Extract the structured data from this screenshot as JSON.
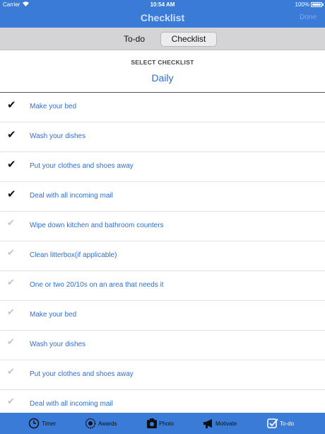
{
  "status_bar": {
    "carrier": "Carrier",
    "time": "10:54 AM",
    "battery": "100%"
  },
  "nav": {
    "title": "Checklist",
    "done_label": "Done"
  },
  "segments": {
    "todo": "To-do",
    "checklist": "Checklist",
    "selected": "Checklist"
  },
  "selector": {
    "label": "SELECT CHECKLIST",
    "value": "Daily"
  },
  "items": [
    {
      "label": "Make your bed",
      "checked": true
    },
    {
      "label": "Wash your dishes",
      "checked": true
    },
    {
      "label": "Put your clothes and shoes away",
      "checked": true
    },
    {
      "label": "Deal with all incoming mail",
      "checked": true
    },
    {
      "label": "Wipe down kitchen and bathroom counters",
      "checked": false
    },
    {
      "label": "Clean litterbox(if applicable)",
      "checked": false
    },
    {
      "label": "One or two 20/10s on an area that needs it",
      "checked": false
    },
    {
      "label": "Make your bed",
      "checked": false
    },
    {
      "label": "Wash your dishes",
      "checked": false
    },
    {
      "label": "Put your clothes and shoes away",
      "checked": false
    },
    {
      "label": "Deal with all incoming mail",
      "checked": false
    }
  ],
  "tabs": [
    {
      "label": "Timer",
      "icon": "clock-icon"
    },
    {
      "label": "Awards",
      "icon": "award-icon"
    },
    {
      "label": "Photo",
      "icon": "camera-icon"
    },
    {
      "label": "Motivate",
      "icon": "megaphone-icon"
    },
    {
      "label": "To-do",
      "icon": "checkbox-icon",
      "active": true
    }
  ],
  "colors": {
    "accent": "#3a7bd8",
    "link": "#2f6fce"
  }
}
